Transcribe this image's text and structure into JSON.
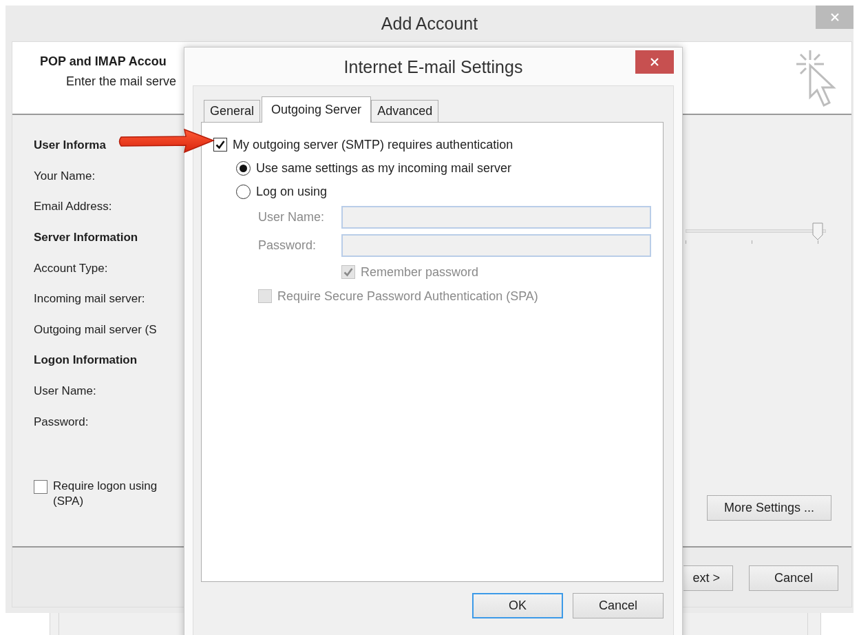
{
  "window": {
    "title": "Add Account"
  },
  "header": {
    "title": "POP and IMAP Accou",
    "subtitle": "Enter the mail serve"
  },
  "sections": [
    {
      "heading": "User Informa",
      "labels": [
        "Your Name:",
        "Email Address:"
      ]
    },
    {
      "heading": "Server Information",
      "labels": [
        "Account Type:",
        "Incoming mail server:",
        "Outgoing mail server (S"
      ]
    },
    {
      "heading": "Logon Information",
      "labels": [
        "User Name:",
        "Password:"
      ]
    }
  ],
  "spa_checkbox": {
    "label_lines": [
      "Require logon using",
      "(SPA)"
    ],
    "checked": false
  },
  "slider": {
    "level": 1
  },
  "more_settings_button": "More Settings ...",
  "footer_buttons": [
    {
      "label": "ext >",
      "kind": "partial"
    },
    {
      "label": "Cancel",
      "kind": "normal"
    }
  ],
  "dialog": {
    "title": "Internet E-mail Settings",
    "tabs": [
      {
        "label": "General",
        "selected": false
      },
      {
        "label": "Outgoing Server",
        "selected": true
      },
      {
        "label": "Advanced",
        "selected": false
      }
    ],
    "options": [
      {
        "kind": "checkbox",
        "label": "My outgoing server (SMTP) requires authentication",
        "checked": true,
        "disabled": false,
        "children": [
          {
            "kind": "radio",
            "label": "Use same settings as my incoming mail server",
            "selected": true,
            "disabled": false
          },
          {
            "kind": "radio",
            "label": "Log on using",
            "selected": false,
            "disabled": false,
            "children": [
              {
                "kind": "field",
                "label": "User Name:",
                "disabled": true
              },
              {
                "kind": "field",
                "label": "Password:",
                "disabled": true
              },
              {
                "kind": "field-checkbox",
                "label": "Remember password",
                "checked": true,
                "disabled": true
              },
              {
                "kind": "checkbox",
                "label": "Require Secure Password Authentication (SPA)",
                "checked": false,
                "disabled": true
              }
            ]
          }
        ]
      }
    ],
    "buttons": [
      {
        "label": "OK",
        "default": true
      },
      {
        "label": "Cancel",
        "default": false
      }
    ]
  }
}
